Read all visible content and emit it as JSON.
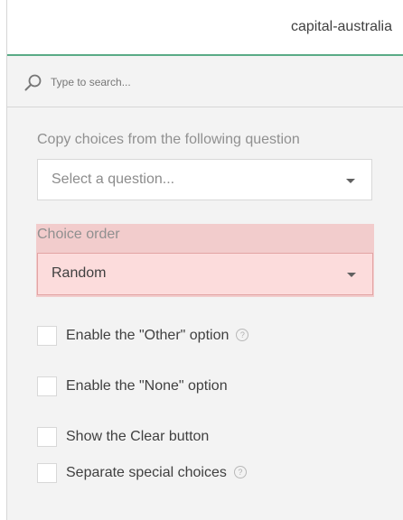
{
  "header": {
    "title": "capital-australia"
  },
  "search": {
    "placeholder": "Type to search..."
  },
  "copy_choices": {
    "label": "Copy choices from the following question",
    "placeholder": "Select a question..."
  },
  "choice_order": {
    "label": "Choice order",
    "value": "Random"
  },
  "options": {
    "other": {
      "label": "Enable the \"Other\" option",
      "help": "?"
    },
    "none": {
      "label": "Enable the \"None\" option"
    },
    "clear": {
      "label": "Show the Clear button"
    },
    "separate": {
      "label": "Separate special choices",
      "help": "?"
    }
  },
  "colors": {
    "accent": "#5aab86",
    "error_background": "#f2cccc",
    "error_field": "#fcdcdc"
  }
}
